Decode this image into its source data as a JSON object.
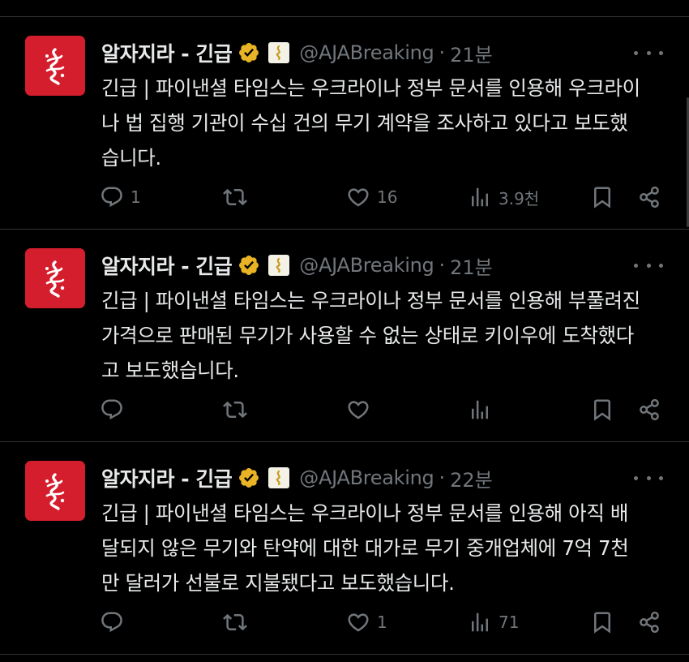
{
  "colors": {
    "background": "#000000",
    "text": "#e7e9ea",
    "secondary": "#71767b",
    "divider": "#2f3336",
    "verified_badge": "#e8b324",
    "avatar_bg": "#d51e2d"
  },
  "tweets": [
    {
      "name": "알자지라 - 긴급",
      "handle": "@AJABreaking",
      "sep": "·",
      "time": "21분",
      "text": "긴급 | 파이낸셜 타임스는 우크라이나 정부 문서를 인용해 우크라이\n나 법 집행 기관이 수십 건의 무기 계약을 조사하고 있다고 보도했\n습니다.",
      "replies": "1",
      "retweets": "",
      "likes": "16",
      "views": "3.9천"
    },
    {
      "name": "알자지라 - 긴급",
      "handle": "@AJABreaking",
      "sep": "·",
      "time": "21분",
      "text": "긴급 | 파이낸셜 타임스는 우크라이나 정부 문서를 인용해 부풀려진\n가격으로 판매된 무기가 사용할 수 없는 상태로 키이우에 도착했다\n고 보도했습니다.",
      "replies": "",
      "retweets": "",
      "likes": "",
      "views": ""
    },
    {
      "name": "알자지라 - 긴급",
      "handle": "@AJABreaking",
      "sep": "·",
      "time": "22분",
      "text": "긴급 | 파이낸셜 타임스는 우크라이나 정부 문서를 인용해 아직 배\n달되지 않은 무기와 탄약에 대한 대가로 무기 중개업체에 7억 7천\n만 달러가 선불로 지불됐다고 보도했습니다.",
      "replies": "",
      "retweets": "",
      "likes": "1",
      "views": "71"
    }
  ],
  "icons": {
    "reply": "reply-icon",
    "retweet": "retweet-icon",
    "like": "like-icon",
    "views": "views-icon",
    "bookmark": "bookmark-icon",
    "share": "share-icon",
    "more": "more-icon",
    "verified": "verified-badge-icon",
    "affiliate": "affiliate-badge-icon"
  }
}
